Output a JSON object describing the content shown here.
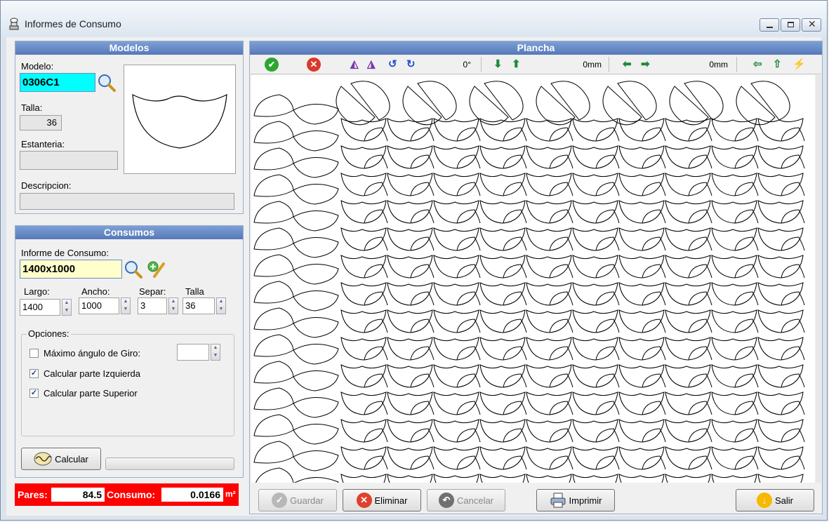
{
  "window": {
    "title": "Informes de Consumo"
  },
  "modelos": {
    "header": "Modelos",
    "modelo_label": "Modelo:",
    "modelo_value": "0306C1",
    "talla_label": "Talla:",
    "talla_value": "36",
    "estanteria_label": "Estanteria:",
    "estanteria_value": "",
    "descripcion_label": "Descripcion:",
    "descripcion_value": ""
  },
  "consumos": {
    "header": "Consumos",
    "informe_label": "Informe de Consumo:",
    "informe_value": "1400x1000",
    "largo_label": "Largo:",
    "largo_value": "1400",
    "ancho_label": "Ancho:",
    "ancho_value": "1000",
    "separ_label": "Separ:",
    "separ_value": "3",
    "talla_label": "Talla",
    "talla_value": "36",
    "opciones_label": "Opciones:",
    "options": [
      {
        "label": "Máximo ángulo de Giro:",
        "checked": false
      },
      {
        "label": "Calcular parte Izquierda",
        "checked": true
      },
      {
        "label": "Calcular parte Superior",
        "checked": true
      }
    ],
    "angle_value": "",
    "calcular_label": "Calcular",
    "progress": 0
  },
  "status": {
    "pares_label": "Pares:",
    "pares_value": "84.5",
    "consumo_label": "Consumo:",
    "consumo_value": "0.0166",
    "unit": "m²"
  },
  "plancha": {
    "header": "Plancha",
    "rotation_value": "0°",
    "vertical_value": "0mm",
    "horizontal_value": "0mm",
    "check_glyph": "✔",
    "rot_ccw_glyph": "↺",
    "rot_cw_glyph": "↻"
  },
  "bottom_buttons": {
    "guardar": "Guardar",
    "eliminar": "Eliminar",
    "cancelar": "Cancelar",
    "imprimir": "Imprimir",
    "salir": "Salir"
  },
  "colors": {
    "modelo_highlight": "#00ffff",
    "informe_highlight": "#ffffcc",
    "status_bg": "#ff0000",
    "header_bg": "#5d7fbf"
  }
}
